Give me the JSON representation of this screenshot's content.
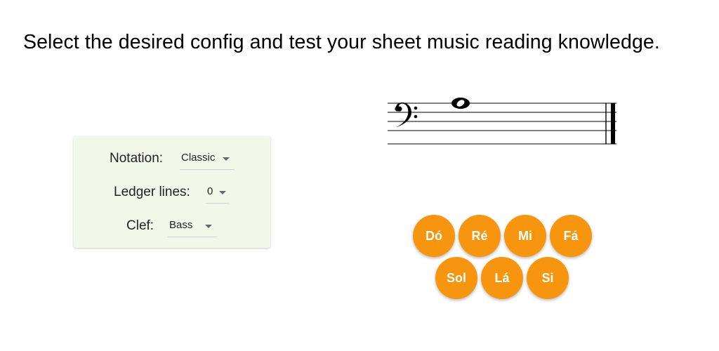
{
  "headline": "Select the desired config and test your sheet music reading knowledge.",
  "config": {
    "notation": {
      "label": "Notation:",
      "value": "Classic"
    },
    "ledger_lines": {
      "label": "Ledger lines:",
      "value": "0"
    },
    "clef": {
      "label": "Clef:",
      "value": "Bass"
    }
  },
  "staff": {
    "clef_icon": "bass-clef-icon",
    "note_icon": "whole-note-icon"
  },
  "answers": [
    "Dó",
    "Ré",
    "Mi",
    "Fá",
    "Sol",
    "Lá",
    "Si"
  ],
  "colors": {
    "panel_bg": "#f1f7e9",
    "button": "#f7950e",
    "button_text": "#ffffff"
  }
}
